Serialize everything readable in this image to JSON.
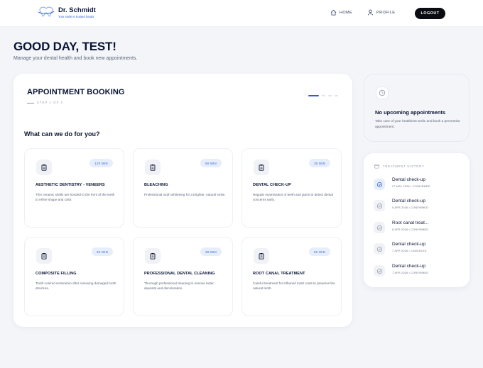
{
  "brand": {
    "name": "Dr. Schmidt",
    "tagline": "Your smile in trusted hands"
  },
  "nav": {
    "home": "HOME",
    "profile": "PROFILE",
    "logout": "LOGOUT"
  },
  "greeting": {
    "title": "GOOD DAY, TEST!",
    "subtitle": "Manage your dental health and book new appointments."
  },
  "booking": {
    "title": "APPOINTMENT BOOKING",
    "step": "STEP 1 OF 4",
    "question": "What can we do for you?",
    "steps_total": 4,
    "steps_active": 1,
    "services": [
      {
        "name": "AESTHETIC DENTISTRY - VENEERS",
        "duration": "120 MIN",
        "description": "Thin ceramic shells are bonded to the front of the teeth to refine shape and color."
      },
      {
        "name": "BLEACHING",
        "duration": "60 MIN",
        "description": "Professional tooth whitening for a brighter, natural smile."
      },
      {
        "name": "DENTAL CHECK-UP",
        "duration": "30 MIN",
        "description": "Regular examination of teeth and gums to detect dental concerns early."
      },
      {
        "name": "COMPOSITE FILLING",
        "duration": "30 MIN",
        "description": "Tooth-colored restoration after removing damaged tooth structure."
      },
      {
        "name": "PROFESSIONAL DENTAL CLEANING",
        "duration": "30 MIN",
        "description": "Thorough professional cleaning to remove tartar, deposits and discoloration."
      },
      {
        "name": "ROOT CANAL TREATMENT",
        "duration": "60 MIN",
        "description": "Careful treatment for inflamed tooth roots to preserve the natural tooth."
      }
    ]
  },
  "upcoming": {
    "title": "No upcoming appointments",
    "description": "Take care of your healthiest smile and book a preventive appointment."
  },
  "history": {
    "heading": "TREATMENT HISTORY",
    "items": [
      {
        "title": "Dental check-up",
        "meta": "27 MAY 2026 • CONFIRMED"
      },
      {
        "title": "Dental check-up",
        "meta": "9 APR 2026 • CONFIRMED"
      },
      {
        "title": "Root canal treat...",
        "meta": "8 APR 2026 • CONFIRMED"
      },
      {
        "title": "Dental check-up",
        "meta": "7 APR 2026 • CANCELED"
      },
      {
        "title": "Dental check-up",
        "meta": "7 APR 2026 • CONFIRMED"
      }
    ]
  },
  "colors": {
    "accent": "#2b5bd7",
    "ink": "#0a1433",
    "logout_bg": "#0b0b12"
  }
}
